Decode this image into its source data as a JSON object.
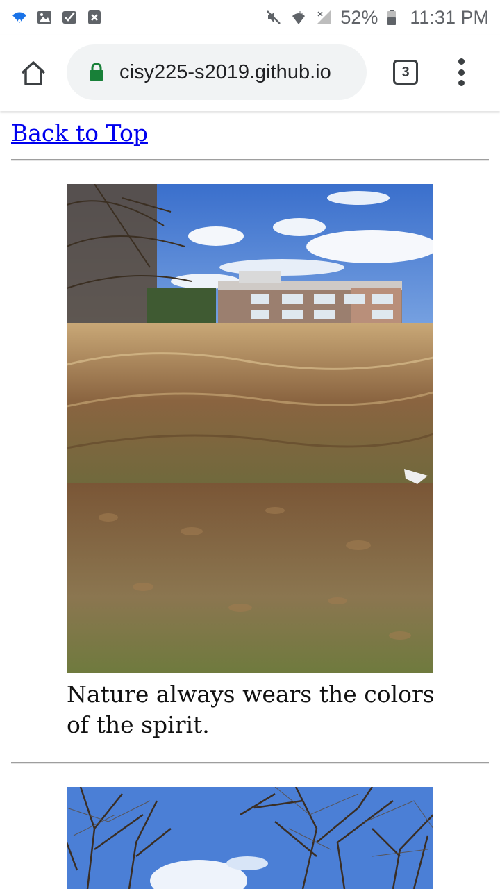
{
  "status_bar": {
    "battery": "52%",
    "time": "11:31 PM"
  },
  "browser": {
    "url": "cisy225-s2019.github.io",
    "tab_count": "3"
  },
  "page": {
    "back_link": "Back to Top",
    "caption_1": "Nature always wears the colors of the spirit."
  }
}
